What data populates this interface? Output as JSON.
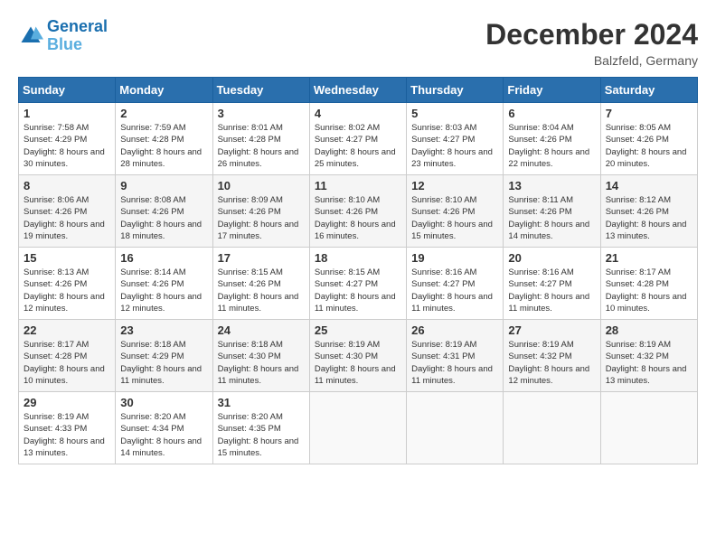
{
  "header": {
    "logo_line1": "General",
    "logo_line2": "Blue",
    "title": "December 2024",
    "subtitle": "Balzfeld, Germany"
  },
  "weekdays": [
    "Sunday",
    "Monday",
    "Tuesday",
    "Wednesday",
    "Thursday",
    "Friday",
    "Saturday"
  ],
  "weeks": [
    [
      {
        "day": "1",
        "sunrise": "7:58 AM",
        "sunset": "4:29 PM",
        "daylight": "8 hours and 30 minutes."
      },
      {
        "day": "2",
        "sunrise": "7:59 AM",
        "sunset": "4:28 PM",
        "daylight": "8 hours and 28 minutes."
      },
      {
        "day": "3",
        "sunrise": "8:01 AM",
        "sunset": "4:28 PM",
        "daylight": "8 hours and 26 minutes."
      },
      {
        "day": "4",
        "sunrise": "8:02 AM",
        "sunset": "4:27 PM",
        "daylight": "8 hours and 25 minutes."
      },
      {
        "day": "5",
        "sunrise": "8:03 AM",
        "sunset": "4:27 PM",
        "daylight": "8 hours and 23 minutes."
      },
      {
        "day": "6",
        "sunrise": "8:04 AM",
        "sunset": "4:26 PM",
        "daylight": "8 hours and 22 minutes."
      },
      {
        "day": "7",
        "sunrise": "8:05 AM",
        "sunset": "4:26 PM",
        "daylight": "8 hours and 20 minutes."
      }
    ],
    [
      {
        "day": "8",
        "sunrise": "8:06 AM",
        "sunset": "4:26 PM",
        "daylight": "8 hours and 19 minutes."
      },
      {
        "day": "9",
        "sunrise": "8:08 AM",
        "sunset": "4:26 PM",
        "daylight": "8 hours and 18 minutes."
      },
      {
        "day": "10",
        "sunrise": "8:09 AM",
        "sunset": "4:26 PM",
        "daylight": "8 hours and 17 minutes."
      },
      {
        "day": "11",
        "sunrise": "8:10 AM",
        "sunset": "4:26 PM",
        "daylight": "8 hours and 16 minutes."
      },
      {
        "day": "12",
        "sunrise": "8:10 AM",
        "sunset": "4:26 PM",
        "daylight": "8 hours and 15 minutes."
      },
      {
        "day": "13",
        "sunrise": "8:11 AM",
        "sunset": "4:26 PM",
        "daylight": "8 hours and 14 minutes."
      },
      {
        "day": "14",
        "sunrise": "8:12 AM",
        "sunset": "4:26 PM",
        "daylight": "8 hours and 13 minutes."
      }
    ],
    [
      {
        "day": "15",
        "sunrise": "8:13 AM",
        "sunset": "4:26 PM",
        "daylight": "8 hours and 12 minutes."
      },
      {
        "day": "16",
        "sunrise": "8:14 AM",
        "sunset": "4:26 PM",
        "daylight": "8 hours and 12 minutes."
      },
      {
        "day": "17",
        "sunrise": "8:15 AM",
        "sunset": "4:26 PM",
        "daylight": "8 hours and 11 minutes."
      },
      {
        "day": "18",
        "sunrise": "8:15 AM",
        "sunset": "4:27 PM",
        "daylight": "8 hours and 11 minutes."
      },
      {
        "day": "19",
        "sunrise": "8:16 AM",
        "sunset": "4:27 PM",
        "daylight": "8 hours and 11 minutes."
      },
      {
        "day": "20",
        "sunrise": "8:16 AM",
        "sunset": "4:27 PM",
        "daylight": "8 hours and 11 minutes."
      },
      {
        "day": "21",
        "sunrise": "8:17 AM",
        "sunset": "4:28 PM",
        "daylight": "8 hours and 10 minutes."
      }
    ],
    [
      {
        "day": "22",
        "sunrise": "8:17 AM",
        "sunset": "4:28 PM",
        "daylight": "8 hours and 10 minutes."
      },
      {
        "day": "23",
        "sunrise": "8:18 AM",
        "sunset": "4:29 PM",
        "daylight": "8 hours and 11 minutes."
      },
      {
        "day": "24",
        "sunrise": "8:18 AM",
        "sunset": "4:30 PM",
        "daylight": "8 hours and 11 minutes."
      },
      {
        "day": "25",
        "sunrise": "8:19 AM",
        "sunset": "4:30 PM",
        "daylight": "8 hours and 11 minutes."
      },
      {
        "day": "26",
        "sunrise": "8:19 AM",
        "sunset": "4:31 PM",
        "daylight": "8 hours and 11 minutes."
      },
      {
        "day": "27",
        "sunrise": "8:19 AM",
        "sunset": "4:32 PM",
        "daylight": "8 hours and 12 minutes."
      },
      {
        "day": "28",
        "sunrise": "8:19 AM",
        "sunset": "4:32 PM",
        "daylight": "8 hours and 13 minutes."
      }
    ],
    [
      {
        "day": "29",
        "sunrise": "8:19 AM",
        "sunset": "4:33 PM",
        "daylight": "8 hours and 13 minutes."
      },
      {
        "day": "30",
        "sunrise": "8:20 AM",
        "sunset": "4:34 PM",
        "daylight": "8 hours and 14 minutes."
      },
      {
        "day": "31",
        "sunrise": "8:20 AM",
        "sunset": "4:35 PM",
        "daylight": "8 hours and 15 minutes."
      },
      null,
      null,
      null,
      null
    ]
  ]
}
